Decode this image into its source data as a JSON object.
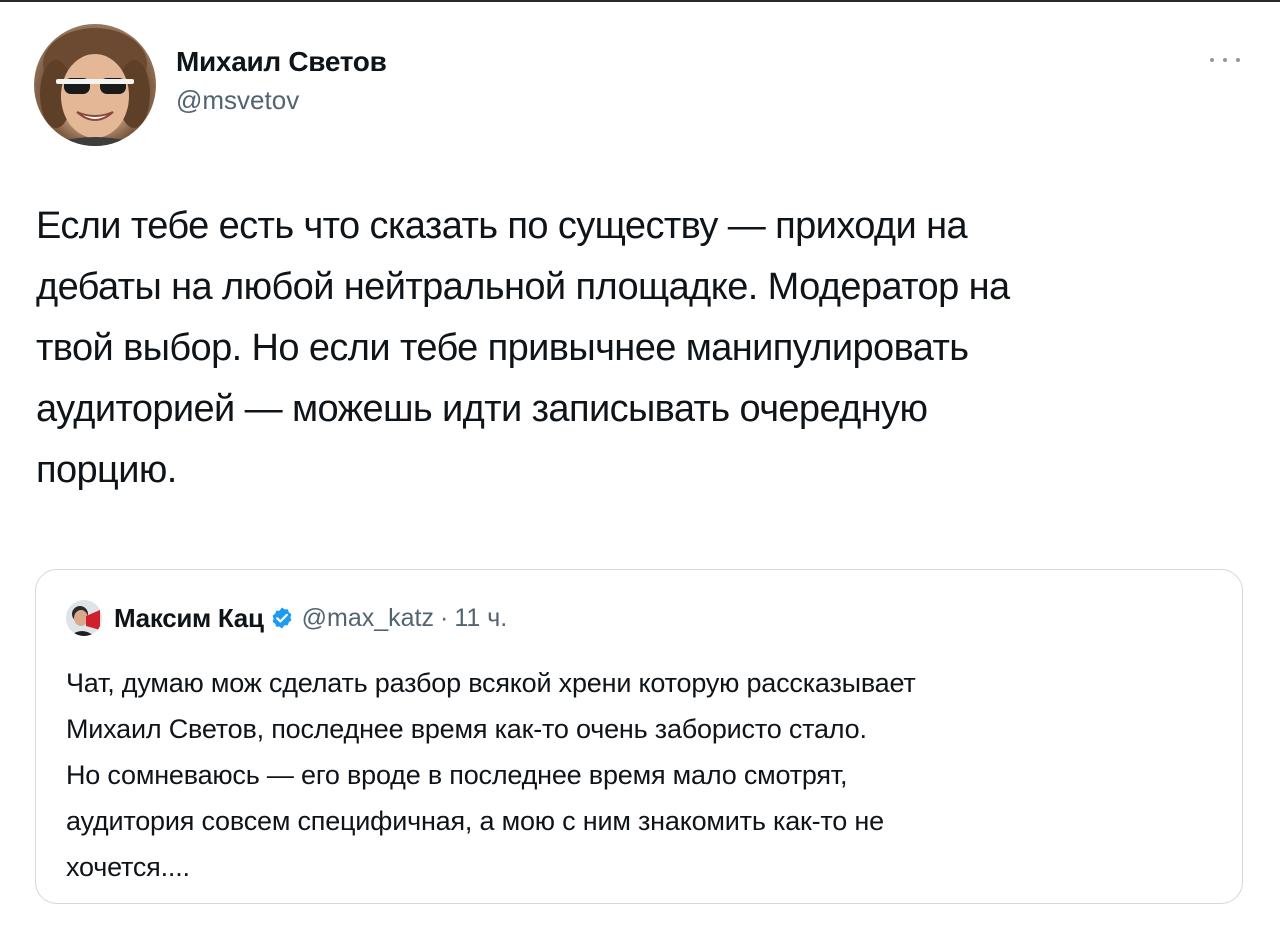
{
  "tweet": {
    "author": {
      "name": "Михаил Светов",
      "handle": "@msvetov",
      "avatar_icon": "profile-photo"
    },
    "more_icon": "more-horizontal-icon",
    "text": "Если тебе есть что сказать по существу — приходи на\nдебаты на любой нейтральной площадке. Модератор на\nтвой выбор. Но если тебе привычнее манипулировать\nаудиторией — можешь идти записывать очередную\nпорцию."
  },
  "quoted_tweet": {
    "author": {
      "name": "Максим Кац",
      "handle": "@max_katz",
      "verified": true,
      "avatar_icon": "profile-photo"
    },
    "separator": "·",
    "time": "11 ч.",
    "text": "Чат, думаю мож сделать разбор всякой хрени которую рассказывает\nМихаил Светов, последнее время как-то очень забористо стало.\nНо сомневаюсь — его вроде в последнее время мало смотрят,\nаудитория совсем специфичная, а мою с ним знакомить как-то не\nхочется...."
  },
  "colors": {
    "text_primary": "#0f1419",
    "text_secondary": "#536471",
    "border": "#cfd9de",
    "verified_blue": "#1d9bf0"
  }
}
